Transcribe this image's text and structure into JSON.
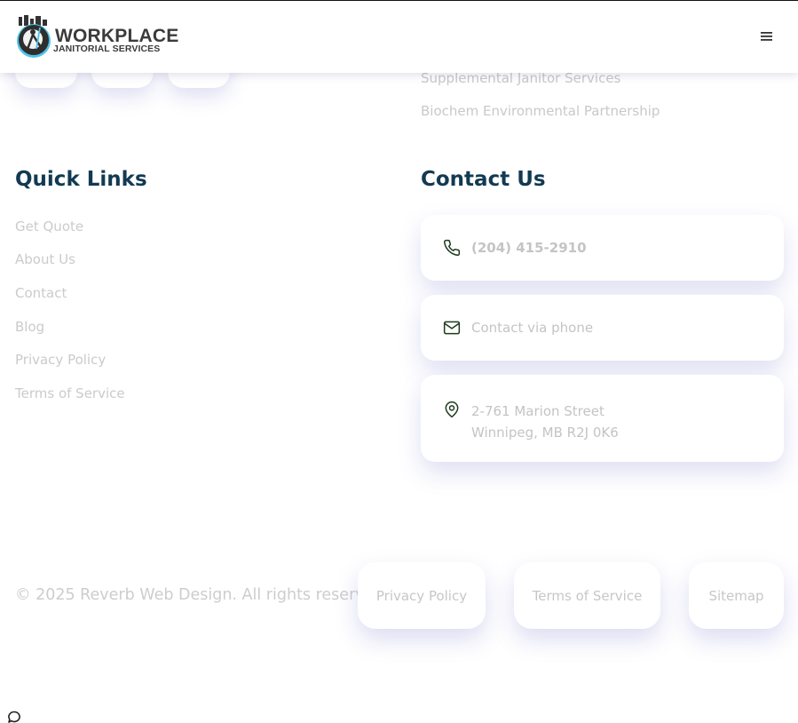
{
  "header": {
    "logo_line1": "WORKPLACE",
    "logo_line2": "JANITORIAL SERVICES",
    "menu_icon": "hamburger-icon"
  },
  "services": {
    "items": [
      "Supplemental Janitor Services",
      "Biochem Environmental Partnership"
    ]
  },
  "quick_links": {
    "title": "Quick Links",
    "items": [
      "Get Quote",
      "About Us",
      "Contact",
      "Blog",
      "Privacy Policy",
      "Terms of Service"
    ]
  },
  "contact": {
    "title": "Contact Us",
    "phone": "(204) 415-2910",
    "email_label": "Contact via phone",
    "address_line1": "2-761 Marion Street",
    "address_line2": "Winnipeg, MB R2J 0K6",
    "icon_color": "#1e3a1e"
  },
  "footer": {
    "copyright": "© 2025 Reverb Web Design. All rights reserved.",
    "links": [
      "Privacy Policy",
      "Terms of Service",
      "Sitemap"
    ]
  },
  "colors": {
    "heading": "#123a52",
    "muted_text": "#c9c9c9",
    "shadow": "#6e6ec8"
  }
}
